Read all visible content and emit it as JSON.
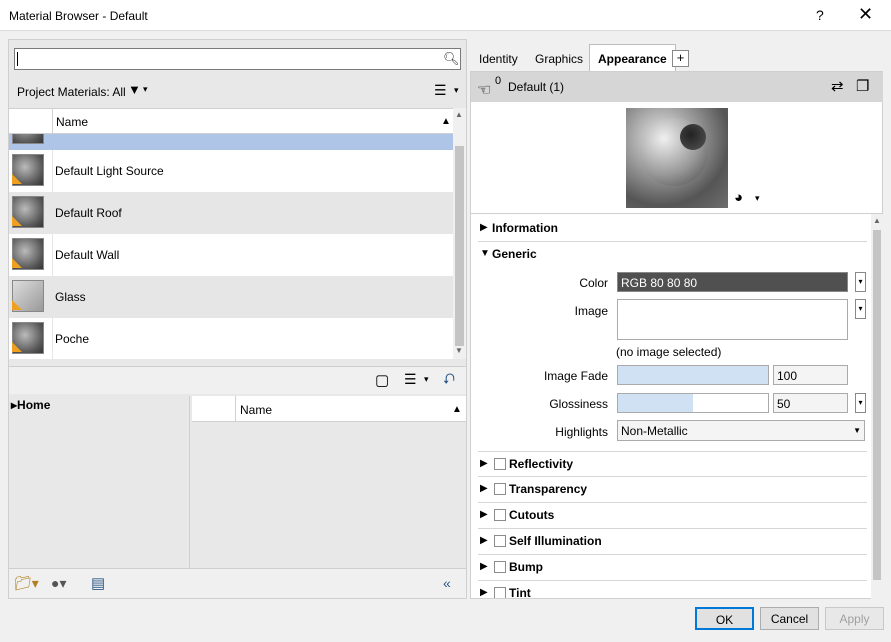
{
  "window": {
    "title": "Material Browser - Default",
    "help": "?",
    "close": "✕"
  },
  "search": {
    "value": "",
    "placeholder": ""
  },
  "project": {
    "label": "Project Materials: All"
  },
  "materials_grid": {
    "column_name": "Name",
    "rows": [
      {
        "name": ""
      },
      {
        "name": "Default Light Source"
      },
      {
        "name": "Default Roof"
      },
      {
        "name": "Default Wall"
      },
      {
        "name": "Glass"
      },
      {
        "name": "Poche"
      }
    ]
  },
  "library": {
    "tree_root": "Home",
    "column_name": "Name"
  },
  "tabs": [
    {
      "label": "Identity"
    },
    {
      "label": "Graphics"
    },
    {
      "label": "Appearance"
    }
  ],
  "tab_add": "+",
  "asset": {
    "count": "0",
    "name": "Default (1)"
  },
  "sections": {
    "information": "Information",
    "generic": "Generic",
    "reflectivity": "Reflectivity",
    "transparency": "Transparency",
    "cutouts": "Cutouts",
    "self_illumination": "Self Illumination",
    "bump": "Bump",
    "tint": "Tint"
  },
  "generic": {
    "color_label": "Color",
    "color_value": "RGB 80 80 80",
    "image_label": "Image",
    "image_note": "(no image selected)",
    "image_fade_label": "Image Fade",
    "image_fade_value": "100",
    "glossiness_label": "Glossiness",
    "glossiness_value": "50",
    "glossiness_level": 0.5,
    "highlights_label": "Highlights",
    "highlights_value": "Non-Metallic"
  },
  "buttons": {
    "ok": "OK",
    "cancel": "Cancel",
    "apply": "Apply"
  },
  "colors": {
    "selection": "#aec5e8",
    "accent": "#0078d7",
    "swatch": "#505050",
    "thumb_badge": "#f0a020"
  }
}
